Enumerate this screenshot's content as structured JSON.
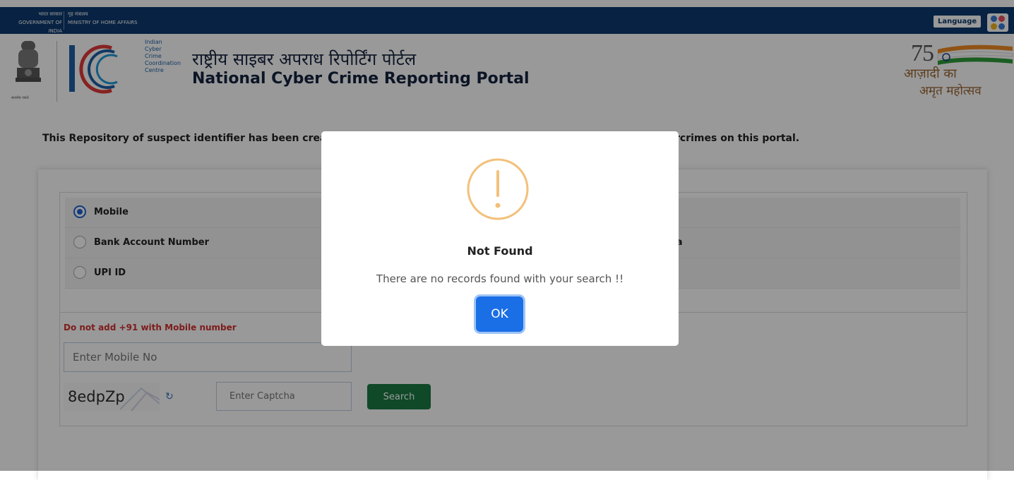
{
  "gov_bar": {
    "gov_hi": "भारत सरकार",
    "gov_en": "GOVERNMENT OF INDIA",
    "ministry_hi": "गृह मंत्रालय",
    "ministry_en": "MINISTRY OF HOME AFFAIRS",
    "language_label": "Language"
  },
  "header": {
    "emblem_caption": "सत्यमेव जयते",
    "i4c_lines": [
      "Indian",
      "Cyber",
      "Crime",
      "Coordination",
      "Centre"
    ],
    "title_hindi": "राष्ट्रीय साइबर अपराध रिपोर्टिंग पोर्टल",
    "title_english": "National Cyber Crime Reporting Portal",
    "azadi_line1": "आज़ादी का",
    "azadi_line2": "अमृत महोत्सव"
  },
  "repository": {
    "text_left": "This Repository of suspect identifier has been crea",
    "text_right": "rcrimes on this portal."
  },
  "form": {
    "options": [
      {
        "label": "Mobile",
        "selected": true
      },
      {
        "label": "Bank Account Number",
        "selected": false
      },
      {
        "label": "UPI ID",
        "selected": false
      }
    ],
    "option_fragment": "dia",
    "warning": "Do not add +91 with Mobile number",
    "mobile_placeholder": "Enter Mobile No",
    "captcha_text": "8edpZp",
    "captcha_placeholder": "Enter Captcha",
    "search_label": "Search"
  },
  "modal": {
    "title": "Not Found",
    "message": "There are no records found with your search !!",
    "ok_label": "OK",
    "icon": "warning-icon"
  },
  "colors": {
    "gov_bar": "#0c3a6e",
    "search_button": "#197b44",
    "ok_button": "#1a6ee6",
    "warning_text": "#d0312d",
    "modal_icon": "#f3c07a"
  }
}
